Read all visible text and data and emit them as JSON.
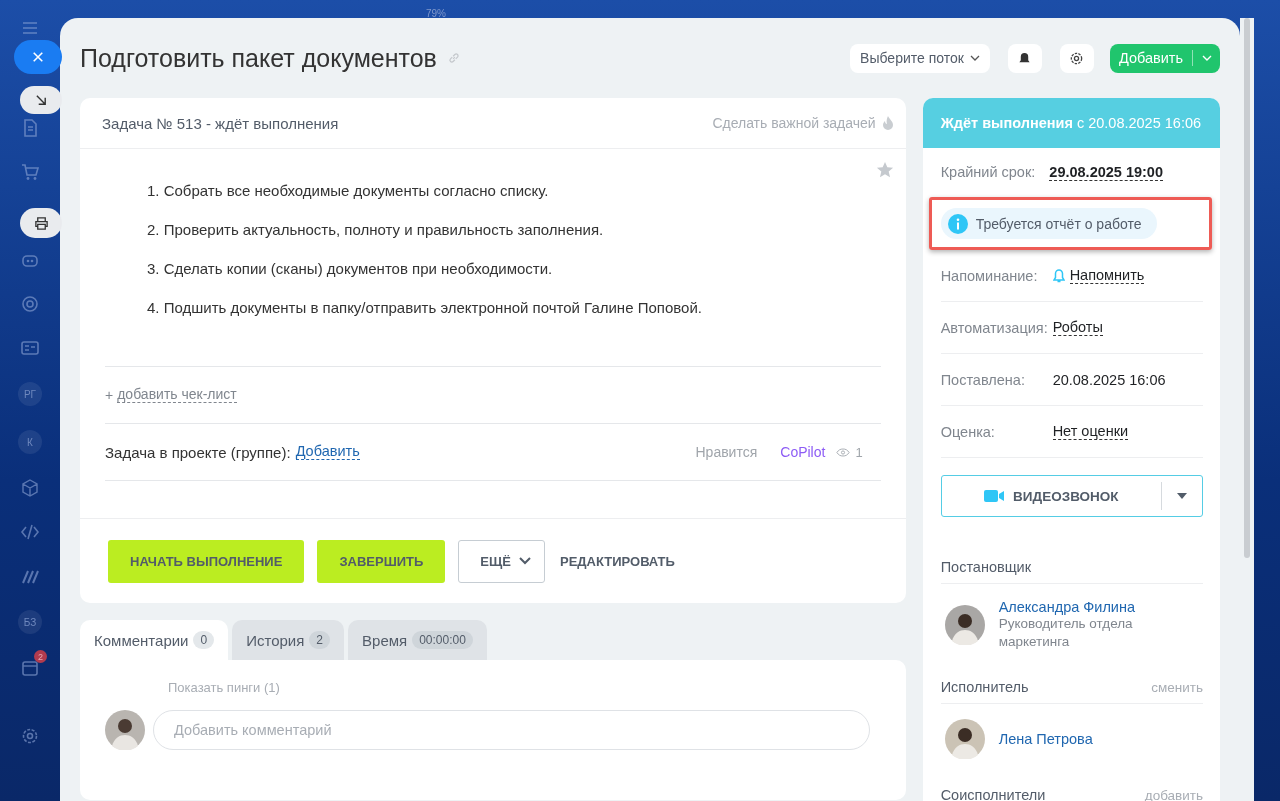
{
  "sidebar": {
    "zoom": "79%",
    "initials": [
      "РГ",
      "К",
      "БЗ"
    ],
    "counter": "2"
  },
  "header": {
    "title": "Подготовить пакет документов",
    "flow_select": "Выберите поток",
    "add_button": "Добавить"
  },
  "card": {
    "heading": "Задача № 513 - ждёт выполнения",
    "important": "Сделать важной задачей",
    "steps": [
      "1. Собрать все необходимые документы согласно списку.",
      "2. Проверить актуальность, полноту и правильность заполнения.",
      "3. Сделать копии (сканы) документов при необходимости.",
      "4. Подшить документы в папку/отправить электронной почтой Галине Поповой."
    ],
    "checklist": {
      "plus": "+",
      "link": "добавить чек-лист"
    },
    "project": {
      "label": "Задача в проекте (группе):",
      "link": "Добавить"
    },
    "likes": "Нравится",
    "copilot": "CoPilot",
    "views": "1",
    "buttons": {
      "start": "НАЧАТЬ ВЫПОЛНЕНИЕ",
      "finish": "ЗАВЕРШИТЬ",
      "more": "ЕЩЁ",
      "edit": "РЕДАКТИРОВАТЬ"
    }
  },
  "tabs": [
    {
      "label": "Комментарии",
      "count": "0",
      "selected": true
    },
    {
      "label": "История",
      "count": "2",
      "selected": false
    },
    {
      "label": "Время",
      "count": "00:00:00",
      "selected": false
    }
  ],
  "comments": {
    "pings": "Показать пинги (1)",
    "placeholder": "Добавить комментарий"
  },
  "side": {
    "status": "**Ждёт выполнения** с 20.08.2025 16:06",
    "deadline": {
      "label": "Крайний срок:",
      "value": "29.08.2025 19:00"
    },
    "notice": {
      "text": "Требуется отчёт о работе",
      "highlighted": true
    },
    "fields": [
      {
        "label": "Напоминание:",
        "value": "Напомнить",
        "kind": "reminder"
      },
      {
        "label": "Автоматизация:",
        "value": "Роботы",
        "kind": "link"
      },
      {
        "label": "Поставлена:",
        "value": "20.08.2025 16:06",
        "kind": "plain"
      },
      {
        "label": "Оценка:",
        "value": "Нет оценки",
        "kind": "link"
      }
    ],
    "video_button": "ВИДЕОЗВОНОК",
    "roles": [
      {
        "title": "Постановщик",
        "people": [
          {
            "name": "Александра Филина",
            "position": "Руководитель отдела маркетинга"
          }
        ]
      },
      {
        "title": "Исполнитель",
        "action": "сменить",
        "people": [
          {
            "name": "Лена Петрова"
          }
        ]
      },
      {
        "title": "Соисполнители",
        "action": "добавить"
      }
    ]
  }
}
